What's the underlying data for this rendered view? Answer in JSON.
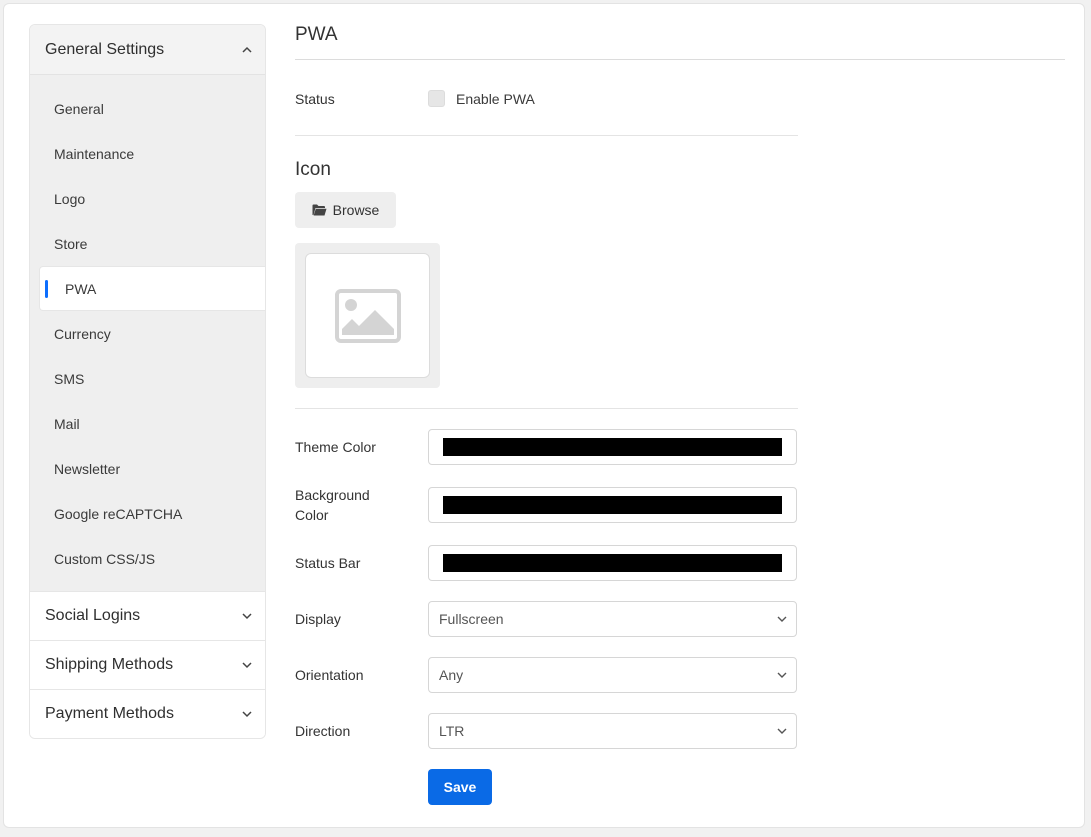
{
  "sidebar": {
    "general_settings": {
      "label": "General Settings",
      "items": [
        {
          "label": "General"
        },
        {
          "label": "Maintenance"
        },
        {
          "label": "Logo"
        },
        {
          "label": "Store"
        },
        {
          "label": "PWA",
          "active": true
        },
        {
          "label": "Currency"
        },
        {
          "label": "SMS"
        },
        {
          "label": "Mail"
        },
        {
          "label": "Newsletter"
        },
        {
          "label": "Google reCAPTCHA"
        },
        {
          "label": "Custom CSS/JS"
        }
      ]
    },
    "social_logins": {
      "label": "Social Logins"
    },
    "shipping_methods": {
      "label": "Shipping Methods"
    },
    "payment_methods": {
      "label": "Payment Methods"
    }
  },
  "main": {
    "title": "PWA",
    "status": {
      "label": "Status",
      "checkbox_label": "Enable PWA",
      "checked": false
    },
    "icon": {
      "title": "Icon",
      "browse_label": "Browse"
    },
    "theme_color": {
      "label": "Theme Color",
      "value": "#000000"
    },
    "background_color": {
      "label": "Background Color",
      "value": "#000000"
    },
    "status_bar": {
      "label": "Status Bar",
      "value": "#000000"
    },
    "display": {
      "label": "Display",
      "value": "Fullscreen"
    },
    "orientation": {
      "label": "Orientation",
      "value": "Any"
    },
    "direction": {
      "label": "Direction",
      "value": "LTR"
    },
    "save_label": "Save"
  },
  "colors": {
    "accent": "#0a6ae6",
    "active_indicator": "#0d6efd"
  }
}
